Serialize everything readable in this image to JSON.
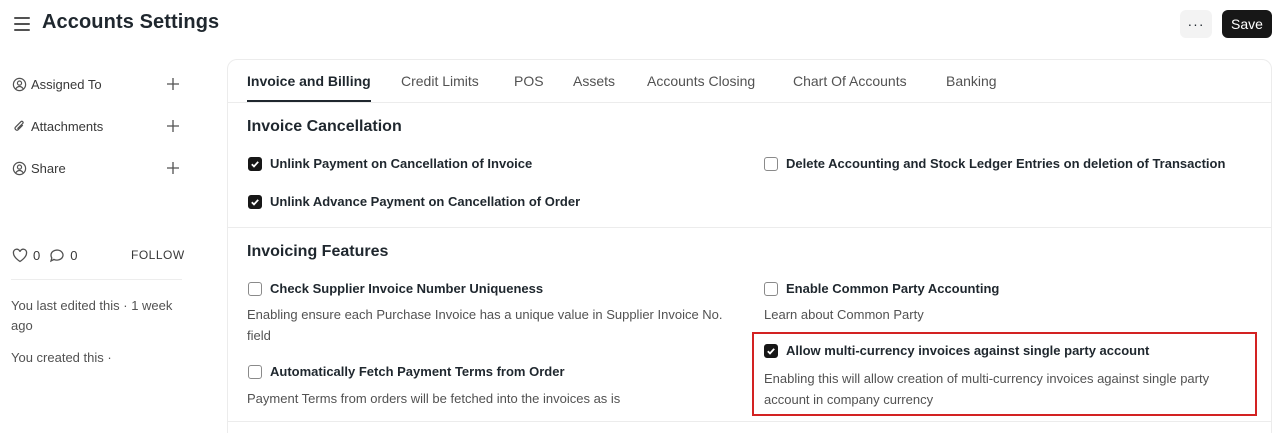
{
  "header": {
    "title": "Accounts Settings",
    "more_label": "···",
    "save_label": "Save"
  },
  "sidebar": {
    "items": [
      {
        "label": "Assigned To",
        "icon": "assign-user-icon"
      },
      {
        "label": "Attachments",
        "icon": "paperclip-icon"
      },
      {
        "label": "Share",
        "icon": "share-user-icon"
      }
    ],
    "likes_count": "0",
    "comments_count": "0",
    "follow_label": "FOLLOW",
    "last_edited": "You last edited this · 1 week ago",
    "created": "You created this ·"
  },
  "tabs": [
    {
      "label": "Invoice and Billing",
      "active": true
    },
    {
      "label": "Credit Limits"
    },
    {
      "label": "POS"
    },
    {
      "label": "Assets"
    },
    {
      "label": "Accounts Closing"
    },
    {
      "label": "Chart Of Accounts"
    },
    {
      "label": "Banking"
    }
  ],
  "sections": {
    "cancellation": {
      "title": "Invoice Cancellation",
      "unlink_payment": {
        "label": "Unlink Payment on Cancellation of Invoice",
        "checked": true
      },
      "delete_entries": {
        "label": "Delete Accounting and Stock Ledger Entries on deletion of Transaction",
        "checked": false
      },
      "unlink_advance": {
        "label": "Unlink Advance Payment on Cancellation of Order",
        "checked": true
      }
    },
    "features": {
      "title": "Invoicing Features",
      "supplier_unique": {
        "label": "Check Supplier Invoice Number Uniqueness",
        "checked": false,
        "description": "Enabling ensure each Purchase Invoice has a unique value in Supplier Invoice No. field"
      },
      "fetch_terms": {
        "label": "Automatically Fetch Payment Terms from Order",
        "checked": false,
        "description": "Payment Terms from orders will be fetched into the invoices as is"
      },
      "common_party": {
        "label": "Enable Common Party Accounting",
        "checked": false,
        "description": "Learn about Common Party"
      },
      "multi_currency": {
        "label": "Allow multi-currency invoices against single party account",
        "checked": true,
        "description": "Enabling this will allow creation of multi-currency invoices against single party account in company currency"
      }
    }
  },
  "colors": {
    "highlight": "#d32222",
    "primary": "#171717"
  }
}
